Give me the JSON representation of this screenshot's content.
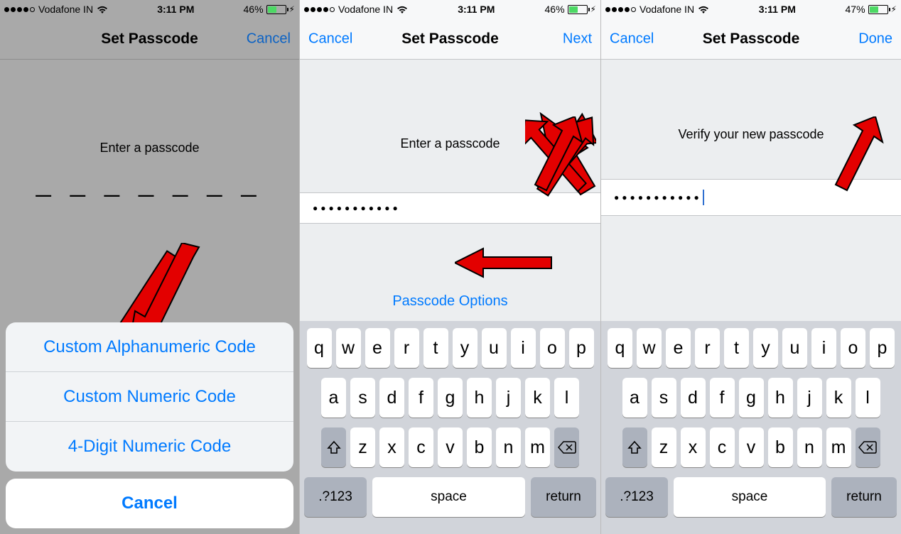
{
  "status": {
    "carrier": "Vodafone IN",
    "time": "3:11 PM",
    "batt1": "46%",
    "batt2": "46%",
    "batt3": "47%"
  },
  "p1": {
    "title": "Set Passcode",
    "cancel": "Cancel",
    "prompt": "Enter a passcode",
    "dashes": "— — — — — — —",
    "sheet": {
      "opt1": "Custom Alphanumeric Code",
      "opt2": "Custom Numeric Code",
      "opt3": "4-Digit Numeric Code",
      "cancel": "Cancel"
    }
  },
  "p2": {
    "left": "Cancel",
    "title": "Set Passcode",
    "right": "Next",
    "prompt": "Enter a passcode",
    "dots": "●●●●●●●●●●●",
    "options": "Passcode Options"
  },
  "p3": {
    "left": "Cancel",
    "title": "Set Passcode",
    "right": "Done",
    "prompt": "Verify your new passcode",
    "dots": "●●●●●●●●●●●"
  },
  "kb": {
    "row1": [
      "q",
      "w",
      "e",
      "r",
      "t",
      "y",
      "u",
      "i",
      "o",
      "p"
    ],
    "row2": [
      "a",
      "s",
      "d",
      "f",
      "g",
      "h",
      "j",
      "k",
      "l"
    ],
    "row3": [
      "z",
      "x",
      "c",
      "v",
      "b",
      "n",
      "m"
    ],
    "mode": ".?123",
    "space": "space",
    "ret": "return"
  }
}
